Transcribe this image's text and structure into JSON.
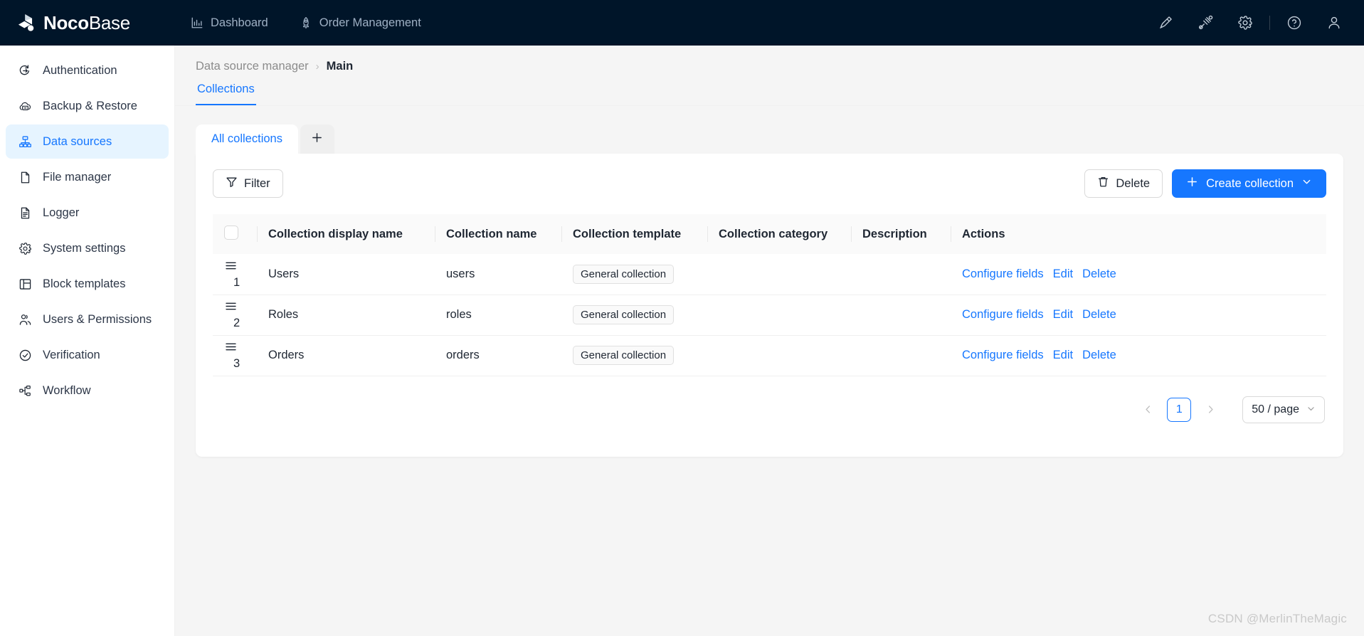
{
  "brand": {
    "name_bold": "Noco",
    "name_light": "Base",
    "logo_icon": "nocobase-cube-logo"
  },
  "topnav": {
    "items": [
      {
        "label": "Dashboard",
        "icon": "bar-chart-icon"
      },
      {
        "label": "Order Management",
        "icon": "rocket-icon"
      }
    ],
    "right_icons": [
      {
        "name": "highlighter-icon"
      },
      {
        "name": "plugin-icon"
      },
      {
        "name": "gear-icon"
      },
      {
        "name": "help-circle-icon"
      },
      {
        "name": "user-avatar-icon"
      }
    ]
  },
  "sidebar": {
    "items": [
      {
        "label": "Authentication",
        "icon": "auth-arrow-icon",
        "active": false
      },
      {
        "label": "Backup & Restore",
        "icon": "cloud-backup-icon",
        "active": false
      },
      {
        "label": "Data sources",
        "icon": "sitemap-icon",
        "active": true
      },
      {
        "label": "File manager",
        "icon": "file-icon",
        "active": false
      },
      {
        "label": "Logger",
        "icon": "file-lines-icon",
        "active": false
      },
      {
        "label": "System settings",
        "icon": "gear-icon",
        "active": false
      },
      {
        "label": "Block templates",
        "icon": "layout-panel-icon",
        "active": false
      },
      {
        "label": "Users & Permissions",
        "icon": "users-icon",
        "active": false
      },
      {
        "label": "Verification",
        "icon": "check-circle-icon",
        "active": false
      },
      {
        "label": "Workflow",
        "icon": "workflow-nodes-icon",
        "active": false
      }
    ]
  },
  "breadcrumb": {
    "root": "Data source manager",
    "separator": "›",
    "current": "Main"
  },
  "page_tabs": [
    {
      "label": "Collections",
      "active": true
    }
  ],
  "collection_tabs": {
    "active_label": "All collections",
    "add_icon": "plus-icon"
  },
  "toolbar": {
    "filter_label": "Filter",
    "filter_icon": "funnel-icon",
    "delete_label": "Delete",
    "delete_icon": "trash-icon",
    "create_label": "Create collection",
    "create_plus_icon": "plus-icon",
    "create_caret_icon": "chevron-down-icon"
  },
  "table": {
    "select_all_checkbox": false,
    "columns": [
      "Collection display name",
      "Collection name",
      "Collection template",
      "Collection category",
      "Description",
      "Actions"
    ],
    "rows": [
      {
        "index": "1",
        "display_name": "Users",
        "name": "users",
        "template": "General collection",
        "category": "",
        "description": "",
        "actions": [
          "Configure fields",
          "Edit",
          "Delete"
        ]
      },
      {
        "index": "2",
        "display_name": "Roles",
        "name": "roles",
        "template": "General collection",
        "category": "",
        "description": "",
        "actions": [
          "Configure fields",
          "Edit",
          "Delete"
        ]
      },
      {
        "index": "3",
        "display_name": "Orders",
        "name": "orders",
        "template": "General collection",
        "category": "",
        "description": "",
        "actions": [
          "Configure fields",
          "Edit",
          "Delete"
        ]
      }
    ]
  },
  "pagination": {
    "prev_icon": "chevron-left-icon",
    "next_icon": "chevron-right-icon",
    "current_page": "1",
    "page_size_label": "50 / page",
    "page_size_caret": "chevron-down-icon"
  },
  "watermark": "CSDN @MerlinTheMagic",
  "colors": {
    "header_bg": "#001529",
    "accent": "#1677ff",
    "active_item_bg": "#e6f4ff",
    "page_bg": "#f5f5f5",
    "panel_bg": "#ffffff",
    "table_head_bg": "#fafafa"
  }
}
